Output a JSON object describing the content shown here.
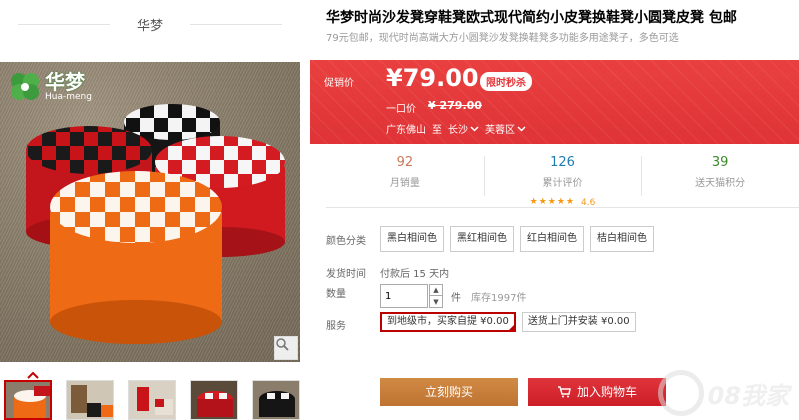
{
  "shop": {
    "name": "华梦"
  },
  "logo": {
    "cn": "华梦",
    "en": "Hua-meng"
  },
  "product": {
    "title": "华梦时尚沙发凳穿鞋凳欧式现代简约小皮凳换鞋凳小圆凳皮凳 包邮",
    "subtitle": "79元包邮，现代时尚高端大方小圆凳沙发凳换鞋凳多功能多用途凳子，多色可选"
  },
  "price": {
    "label": "促销价",
    "current": "¥79.00",
    "badge": "限时秒杀",
    "original_label": "一口价",
    "original": "¥ 279.00",
    "ship_from": "广东佛山",
    "ship_to_word": "至",
    "city": "长沙",
    "district": "芙蓉区",
    "accent_color": "#e4393c"
  },
  "stats": [
    {
      "value": "92",
      "label": "月销量"
    },
    {
      "value": "126",
      "label": "累计评价",
      "rating": "4.6",
      "stars": 5
    },
    {
      "value": "39",
      "label": "送天猫积分"
    }
  ],
  "options": {
    "color_label": "颜色分类",
    "colors": [
      "黑白相间色",
      "黑红相间色",
      "红白相间色",
      "桔白相间色"
    ],
    "ship_time_label": "发货时间",
    "ship_time_value": "付款后 15 天内",
    "qty_label": "数量",
    "qty_value": "1",
    "qty_unit": "件",
    "stock": "库存1997件",
    "service_label": "服务",
    "services": [
      "到地级市，买家自提  ¥0.00",
      "送货上门并安装  ¥0.00"
    ],
    "active_service": 0
  },
  "actions": {
    "buy": "立刻购买",
    "cart": "加入购物车"
  },
  "watermark": {
    "text": "08我家"
  }
}
